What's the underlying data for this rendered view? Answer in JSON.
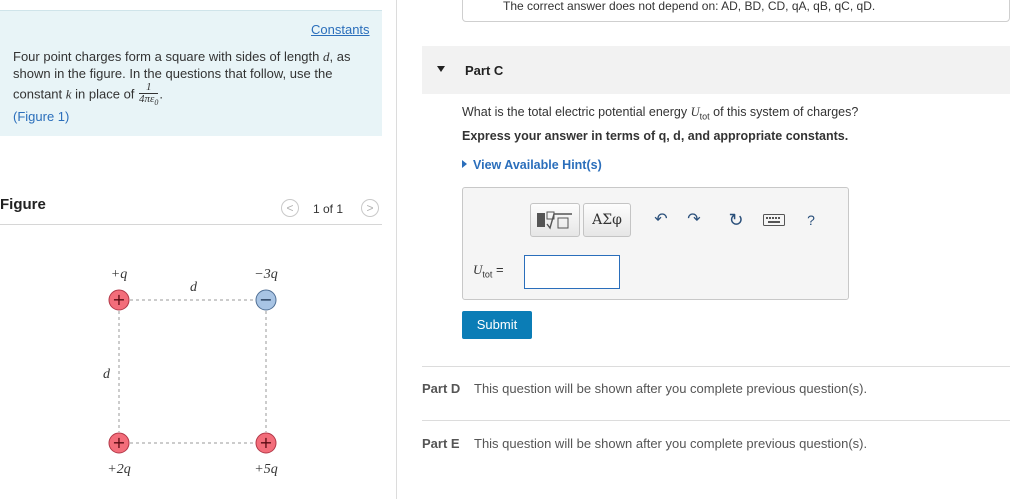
{
  "problem": {
    "constants_link": "Constants",
    "text_line1_pre": "Four point charges form a square with sides of length ",
    "text_line1_var": "d",
    "text_line1_post": ", as shown in the figure. In the questions that follow, use the constant ",
    "text_k": "k",
    "text_line2_mid": " in place of ",
    "frac_num": "1",
    "frac_den": "4πε",
    "frac_den_sub": "0",
    "text_end": ".",
    "figure_link": "(Figure 1)"
  },
  "figure_panel": {
    "title": "Figure",
    "page_count": "1 of 1",
    "prev_glyph": "<",
    "next_glyph": ">"
  },
  "figure": {
    "charges": [
      {
        "label": "+q",
        "sign": "+",
        "color": "#f36d7a"
      },
      {
        "label": "−3q",
        "sign": "−",
        "color": "#a8c4e4"
      },
      {
        "label": "+2q",
        "sign": "+",
        "color": "#f36d7a"
      },
      {
        "label": "+5q",
        "sign": "+",
        "color": "#f36d7a"
      }
    ],
    "side_label_top": "d",
    "side_label_left": "d"
  },
  "prev_answer": {
    "text": "The correct answer does not depend on: AD, BD, CD, qA, qB, qC, qD."
  },
  "part_c": {
    "title": "Part C",
    "question_pre": "What is the total electric potential energy ",
    "question_var": "U",
    "question_sub": "tot",
    "question_post": " of this system of charges?",
    "instruction": "Express your answer in terms of q, d, and appropriate constants.",
    "hints": "View Available Hint(s)",
    "greek_button": "ΑΣφ",
    "answer_var": "U",
    "answer_sub": "tot",
    "answer_eq": " =",
    "answer_value": "",
    "help_glyph": "?",
    "submit": "Submit"
  },
  "part_d": {
    "label": "Part D",
    "message": "This question will be shown after you complete previous question(s)."
  },
  "part_e": {
    "label": "Part E",
    "message": "This question will be shown after you complete previous question(s)."
  },
  "colors": {
    "link": "#2a6ebb",
    "submit": "#0b7db6",
    "info_bg": "#e8f4f7",
    "positive_charge": "#f36d7a",
    "negative_charge": "#a8c4e4"
  }
}
